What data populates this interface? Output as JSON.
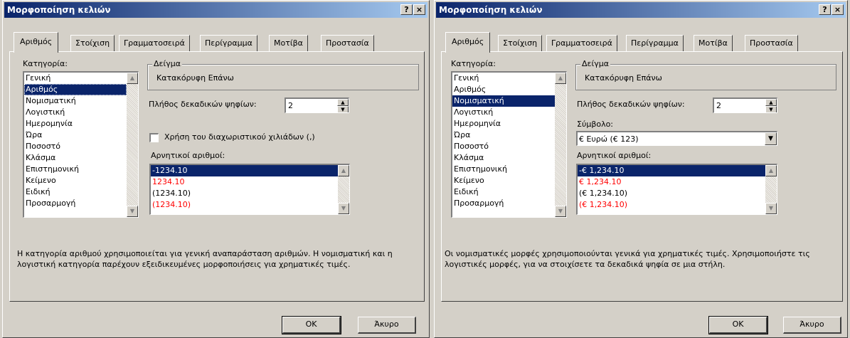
{
  "dialogs": [
    {
      "title": "Μορφοποίηση κελιών",
      "help_button": "?",
      "close_button": "×",
      "tabs": [
        "Αριθμός",
        "Στοίχιση",
        "Γραμματοσειρά",
        "Περίγραμμα",
        "Μοτίβα",
        "Προστασία"
      ],
      "category_label": "Κατηγορία:",
      "categories": [
        "Γενική",
        "Αριθμός",
        "Νομισματική",
        "Λογιστική",
        "Ημερομηνία",
        "Ώρα",
        "Ποσοστό",
        "Κλάσμα",
        "Επιστημονική",
        "Κείμενο",
        "Ειδική",
        "Προσαρμογή"
      ],
      "selected_category": "Αριθμός",
      "sample_label": "Δείγμα",
      "sample_value": "Κατακόρυφη Επάνω",
      "decimals_label": "Πλήθος δεκαδικών ψηφίων:",
      "decimals_value": "2",
      "thousands_label": "Χρήση του διαχωριστικού χιλιάδων (,)",
      "thousands_checked": false,
      "negative_label": "Αρνητικοί αριθμοί:",
      "negative_options": [
        {
          "text": "-1234.10",
          "color": "#000000"
        },
        {
          "text": "1234.10",
          "color": "#ff0000"
        },
        {
          "text": "(1234.10)",
          "color": "#000000"
        },
        {
          "text": "(1234.10)",
          "color": "#ff0000"
        }
      ],
      "description": "Η κατηγορία αριθμού χρησιμοποιείται για γενική αναπαράσταση αριθμών.  Η νομισματική και η λογιστική κατηγορία παρέχουν εξειδικευμένες μορφοποιήσεις για χρηματικές τιμές.",
      "ok_label": "OK",
      "cancel_label": "Άκυρο"
    },
    {
      "title": "Μορφοποίηση κελιών",
      "help_button": "?",
      "close_button": "×",
      "tabs": [
        "Αριθμός",
        "Στοίχιση",
        "Γραμματοσειρά",
        "Περίγραμμα",
        "Μοτίβα",
        "Προστασία"
      ],
      "category_label": "Κατηγορία:",
      "categories": [
        "Γενική",
        "Αριθμός",
        "Νομισματική",
        "Λογιστική",
        "Ημερομηνία",
        "Ώρα",
        "Ποσοστό",
        "Κλάσμα",
        "Επιστημονική",
        "Κείμενο",
        "Ειδική",
        "Προσαρμογή"
      ],
      "selected_category": "Νομισματική",
      "sample_label": "Δείγμα",
      "sample_value": "Κατακόρυφη Επάνω",
      "decimals_label": "Πλήθος δεκαδικών ψηφίων:",
      "decimals_value": "2",
      "symbol_label": "Σύμβολο:",
      "symbol_value": "€ Ευρώ (€ 123)",
      "negative_label": "Αρνητικοί αριθμοί:",
      "negative_options": [
        {
          "text": "-€ 1,234.10",
          "color": "#000000"
        },
        {
          "text": "€ 1,234.10",
          "color": "#ff0000"
        },
        {
          "text": "(€ 1,234.10)",
          "color": "#000000"
        },
        {
          "text": "(€ 1,234.10)",
          "color": "#ff0000"
        }
      ],
      "description": "Οι νομισματικές μορφές χρησιμοποιούνται γενικά για χρηματικές τιμές. Χρησιμοποιήστε τις λογιστικές μορφές, για να στοιχίσετε τα δεκαδικά ψηφία σε μια στήλη.",
      "ok_label": "OK",
      "cancel_label": "Άκυρο"
    }
  ]
}
